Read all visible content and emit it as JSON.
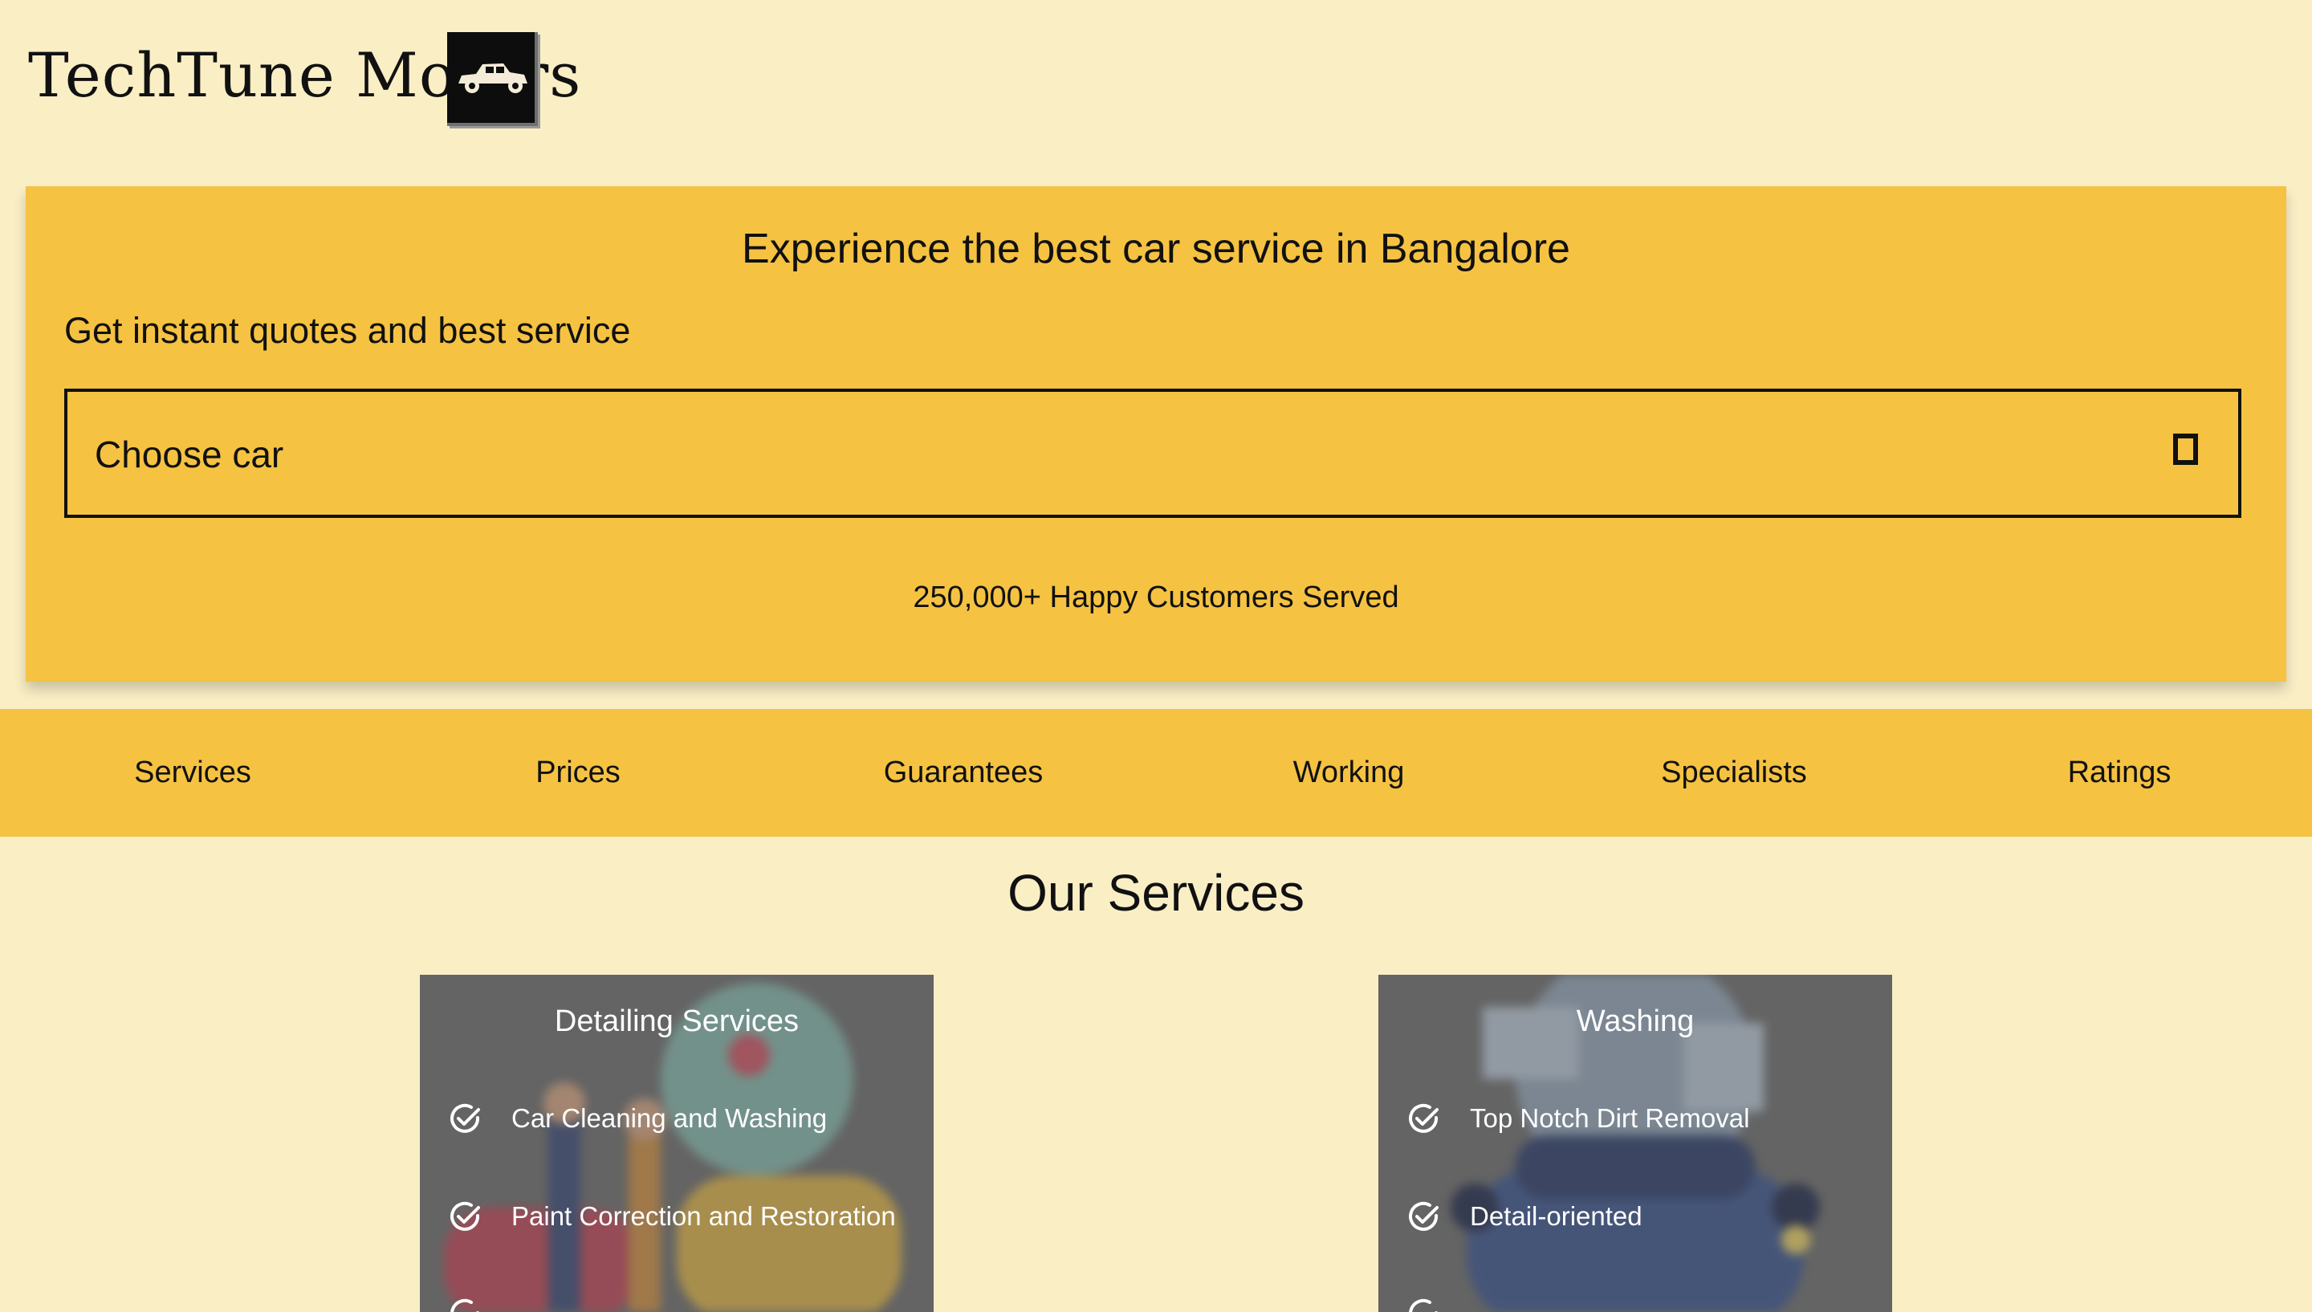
{
  "header": {
    "brand_name": "TechTune Motors",
    "logo_icon": "vintage-car-icon"
  },
  "hero": {
    "title": "Experience the best car service in Bangalore",
    "subtitle": "Get instant quotes and best service",
    "car_select_label": "Choose car",
    "customers_text": "250,000+ Happy Customers Served"
  },
  "nav": {
    "items": [
      "Services",
      "Prices",
      "Guarantees",
      "Working",
      "Specialists",
      "Ratings"
    ]
  },
  "services": {
    "title": "Our Services",
    "cards": [
      {
        "title": "Detailing Services",
        "items": [
          "Car Cleaning and Washing",
          "Paint Correction and Restoration"
        ]
      },
      {
        "title": "Washing",
        "items": [
          "Top Notch Dirt Removal",
          "Detail-oriented"
        ]
      }
    ]
  },
  "colors": {
    "page_bg": "#faeec5",
    "accent_yellow": "#f5c242",
    "card_bg": "#646464"
  }
}
